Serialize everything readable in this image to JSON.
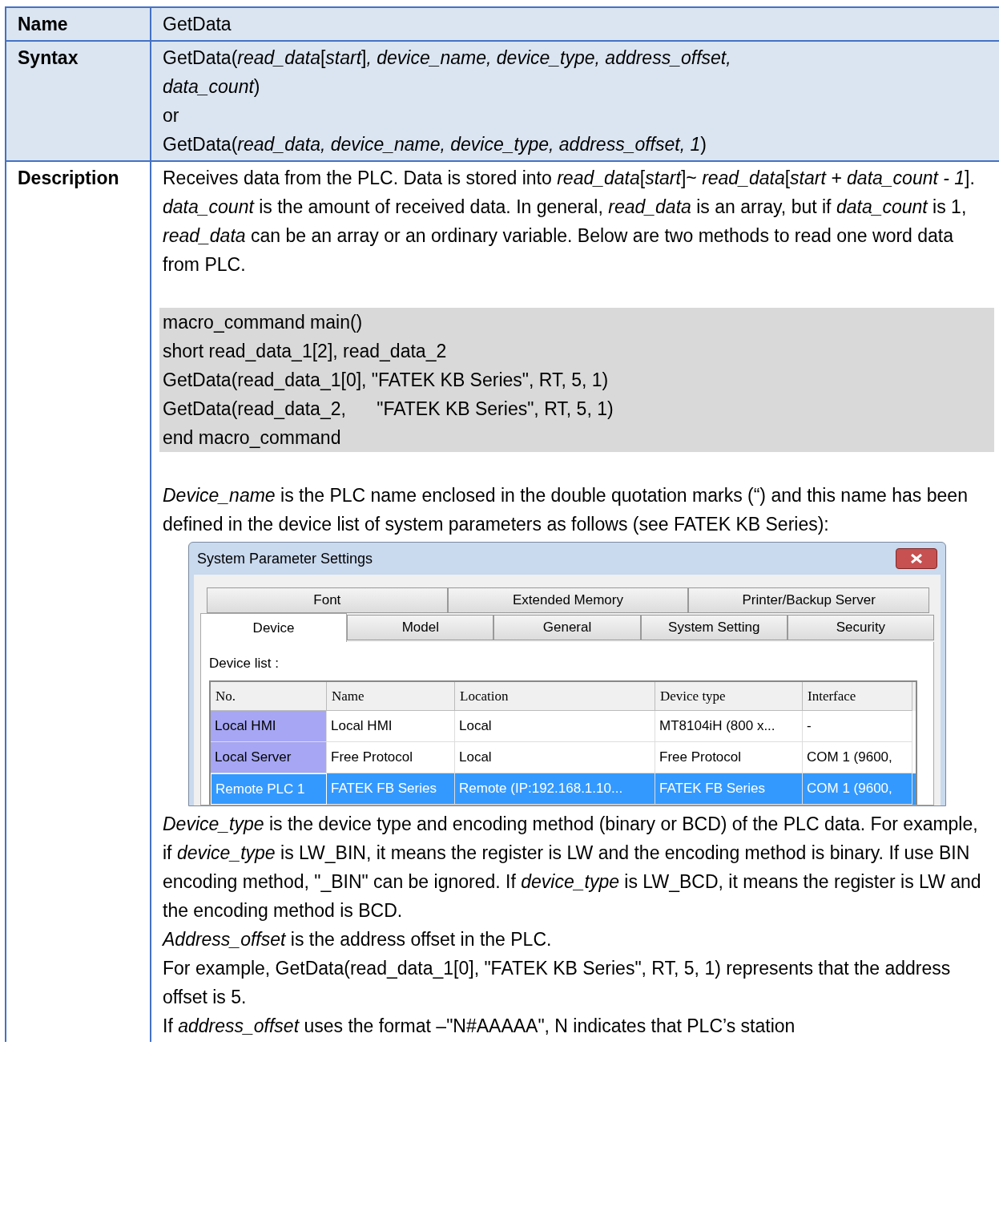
{
  "rows": [
    {
      "label": "Name",
      "lines": [
        "GetData"
      ]
    },
    {
      "label": "Syntax",
      "lines": [
        "GetData(*read_data*[*start*]*, device_name, device_type, address_offset,*",
        "*data_count*)",
        "or",
        "GetData(*read_data, device_name, device_type, address_offset, 1*)"
      ]
    }
  ],
  "description": {
    "label": "Description",
    "intro": [
      "Receives data from the PLC. Data is stored into *read_data*[*start*]~ *read_data*[*start + data_count - 1*].",
      "*data_count* is the amount of received data. In general, *read_data* is an array, but if *data_count* is 1, *read_data* can be an array or an ordinary variable. Below are two methods to read one word data from PLC."
    ],
    "code": [
      "macro_command main()",
      "short read_data_1[2], read_data_2",
      "GetData(read_data_1[0], \"FATEK KB Series\", RT, 5, 1)",
      "GetData(read_data_2,      \"FATEK KB Series\", RT, 5, 1)",
      "end macro_command"
    ],
    "middle": [
      "*Device_name* is the PLC name enclosed in the double quotation marks (“) and this name has been defined in the device list of system parameters as follows (see FATEK KB Series):"
    ],
    "dialog": {
      "title": "System Parameter Settings",
      "tab_rows": [
        [
          {
            "label": "Font",
            "selected": false
          },
          {
            "label": "Extended Memory",
            "selected": false
          },
          {
            "label": "Printer/Backup Server",
            "selected": false
          }
        ],
        [
          {
            "label": "Device",
            "selected": true
          },
          {
            "label": "Model",
            "selected": false
          },
          {
            "label": "General",
            "selected": false
          },
          {
            "label": "System Setting",
            "selected": false
          },
          {
            "label": "Security",
            "selected": false
          }
        ]
      ],
      "list_label": "Device list :",
      "columns": [
        "No.",
        "Name",
        "Location",
        "Device type",
        "Interface"
      ],
      "rows": [
        {
          "cells": [
            "Local HMI",
            "Local HMI",
            "Local",
            "MT8104iH (800 x...",
            "-"
          ],
          "selected": false
        },
        {
          "cells": [
            "Local Server",
            "Free Protocol",
            "Local",
            "Free Protocol",
            "COM 1 (9600,"
          ],
          "selected": false
        },
        {
          "cells": [
            "Remote PLC 1",
            "FATEK FB Series",
            "Remote (IP:192.168.1.10...",
            "FATEK FB Series",
            "COM 1 (9600,"
          ],
          "selected": true
        }
      ]
    },
    "after": [
      "*Device_type* is the device type and encoding method (binary or BCD) of the PLC data. For example, if *device_type* is LW_BIN, it means the register is LW and the encoding method is binary. If use BIN encoding method, \"_BIN\" can be ignored. If *device_type* is LW_BCD, it means the register is LW and the encoding method is BCD.",
      "*Address_offset* is the address offset in the PLC.",
      "For example, GetData(read_data_1[0], \"FATEK KB Series\", RT, 5, 1) represents that the address offset is 5.",
      "If *address_offset* uses the format –\"N#AAAAA\", N indicates that PLC’s station"
    ]
  }
}
